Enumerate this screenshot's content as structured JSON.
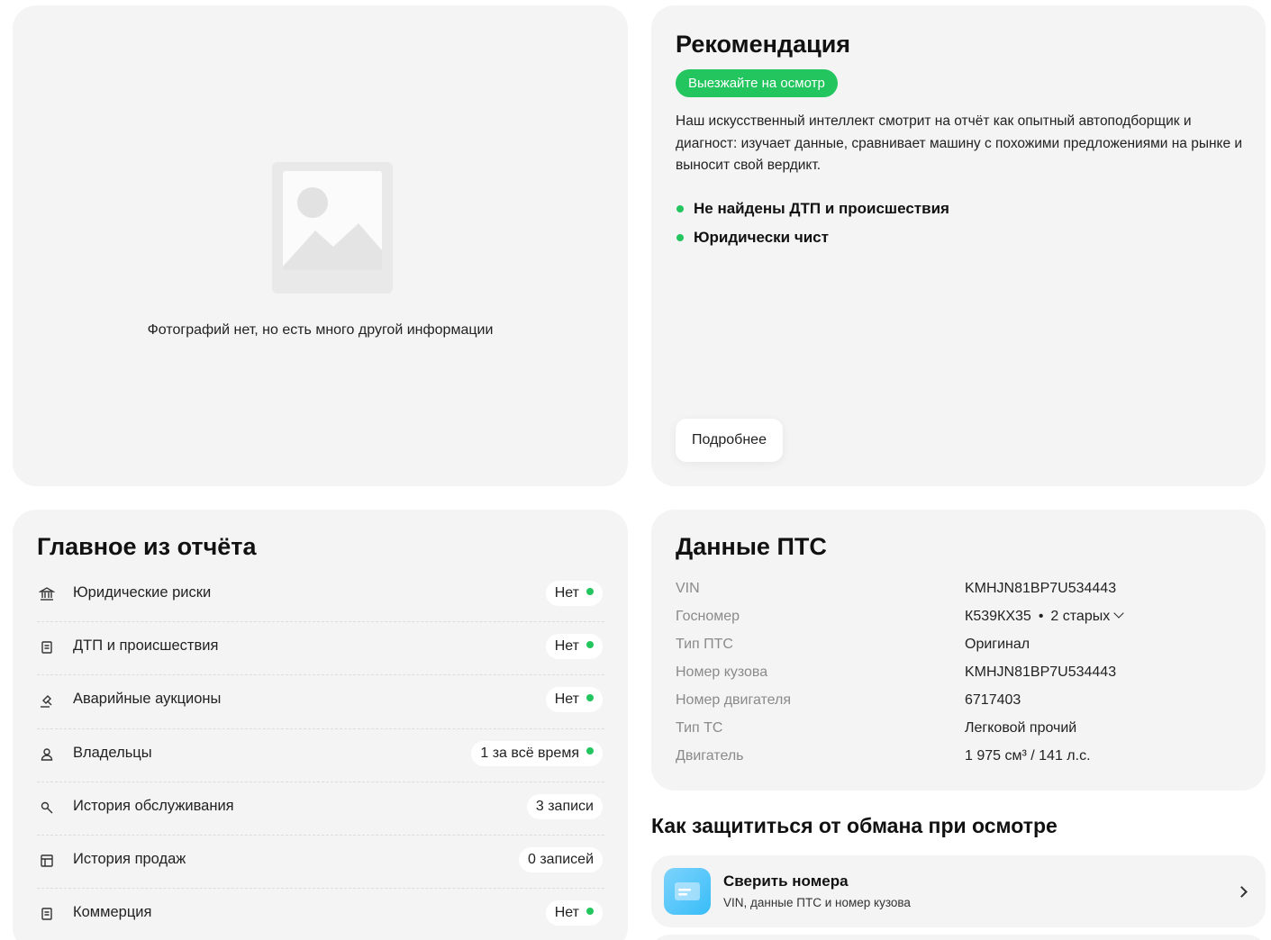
{
  "photo": {
    "caption": "Фотографий нет, но есть много другой информации"
  },
  "recommendation": {
    "title": "Рекомендация",
    "badge": "Выезжайте на осмотр",
    "text": "Наш искусственный интеллект смотрит на отчёт как опытный автоподборщик и диагност: изучает данные, сравнивает машину с похожими предложениями на рынке и выносит свой вердикт.",
    "points": [
      "Не найдены ДТП и происшествия",
      "Юридически чист"
    ],
    "more_label": "Подробнее",
    "accent": "#22c55e"
  },
  "summary": {
    "title": "Главное из отчёта",
    "rows": [
      {
        "icon": "bank-icon",
        "label": "Юридические риски",
        "value": "Нет",
        "dot": true
      },
      {
        "icon": "document-icon",
        "label": "ДТП и происшествия",
        "value": "Нет",
        "dot": true
      },
      {
        "icon": "auction-icon",
        "label": "Аварийные аукционы",
        "value": "Нет",
        "dot": true
      },
      {
        "icon": "person-icon",
        "label": "Владельцы",
        "value": "1 за всё время",
        "dot": true
      },
      {
        "icon": "wrench-icon",
        "label": "История обслуживания",
        "value": "3 записи",
        "dot": false
      },
      {
        "icon": "receipt-icon",
        "label": "История продаж",
        "value": "0 записей",
        "dot": false
      },
      {
        "icon": "document-icon",
        "label": "Коммерция",
        "value": "Нет",
        "dot": true
      }
    ]
  },
  "pts": {
    "title": "Данные ПТС",
    "rows": [
      {
        "key": "VIN",
        "value": "KMHJN81BP7U534443"
      },
      {
        "key": "Госномер",
        "value": "К539КХ35",
        "extra": "2 старых"
      },
      {
        "key": "Тип ПТС",
        "value": "Оригинал"
      },
      {
        "key": "Номер кузова",
        "value": "KMHJN81BP7U534443"
      },
      {
        "key": "Номер двигателя",
        "value": "6717403"
      },
      {
        "key": "Тип ТС",
        "value": "Легковой прочий"
      },
      {
        "key": "Двигатель",
        "value": "1 975 см³ / 141 л.с."
      }
    ]
  },
  "protect": {
    "title": "Как защититься от обмана при осмотре",
    "item_title": "Сверить номера",
    "item_subtitle": "VIN, данные ПТС и номер кузова"
  }
}
